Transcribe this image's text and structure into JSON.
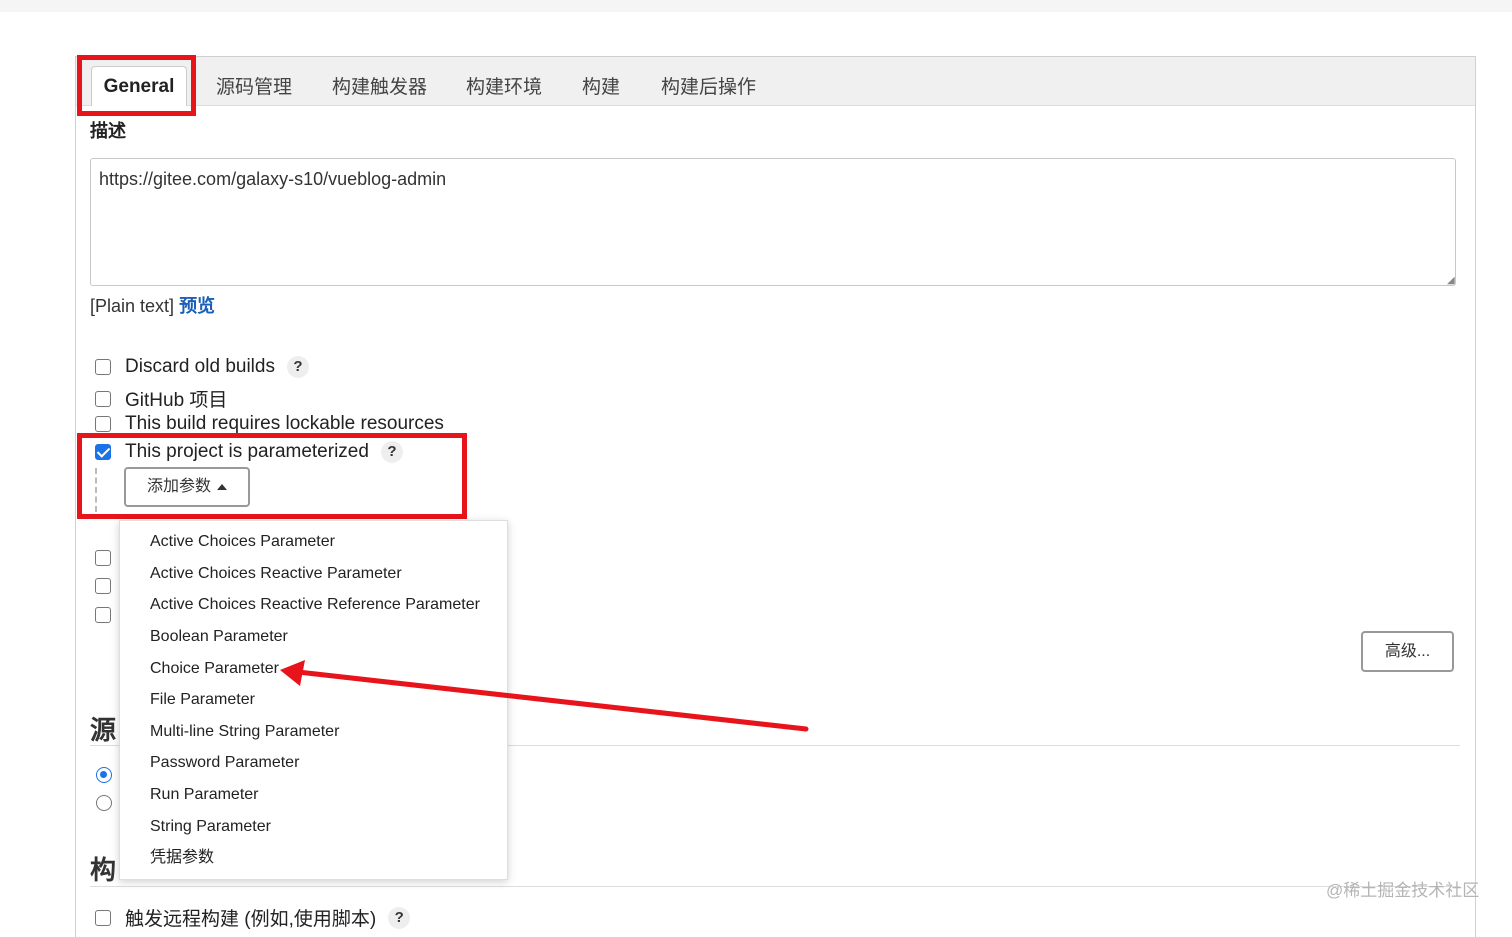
{
  "tabs": [
    {
      "label": "General"
    },
    {
      "label": "源码管理"
    },
    {
      "label": "构建触发器"
    },
    {
      "label": "构建环境"
    },
    {
      "label": "构建"
    },
    {
      "label": "构建后操作"
    }
  ],
  "description": {
    "label": "描述",
    "value": "https://gitee.com/galaxy-s10/vueblog-admin",
    "plain_text": "[Plain text]",
    "preview_link": "预览"
  },
  "options": [
    {
      "label": "Discard old builds",
      "checked": false,
      "help": "?"
    },
    {
      "label": "GitHub 项目",
      "checked": false
    },
    {
      "label": "This build requires lockable resources",
      "checked": false
    },
    {
      "label": "This project is parameterized",
      "checked": true,
      "help": "?"
    }
  ],
  "add_param_button": "添加参数",
  "param_menu": [
    "Active Choices Parameter",
    "Active Choices Reactive Parameter",
    "Active Choices Reactive Reference Parameter",
    "Boolean Parameter",
    "Choice Parameter",
    "File Parameter",
    "Multi-line String Parameter",
    "Password Parameter",
    "Run Parameter",
    "String Parameter",
    "凭据参数"
  ],
  "advanced_button": "高级...",
  "section_source_partial": "源",
  "section_build_partial": "构",
  "trigger_option": {
    "label": "触发远程构建 (例如,使用脚本)",
    "help": "?"
  },
  "watermark": "@稀土掘金技术社区",
  "colors": {
    "highlight": "#e8141b",
    "link": "#1b5fb6",
    "accent": "#1a73e8"
  }
}
